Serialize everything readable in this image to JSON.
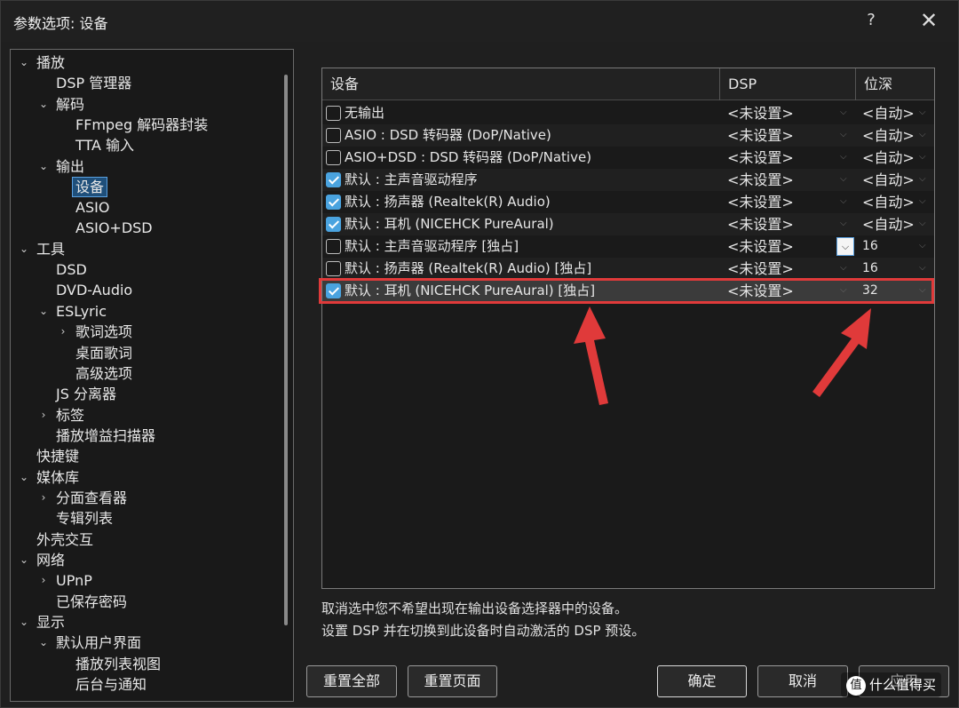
{
  "window": {
    "title": "参数选项: 设备",
    "help_label": "?",
    "close_label": "✕"
  },
  "tree": {
    "items": [
      {
        "label": "播放",
        "arrow": "⌄"
      },
      {
        "label": "DSP 管理器",
        "arrow": ""
      },
      {
        "label": "解码",
        "arrow": "⌄"
      },
      {
        "label": "FFmpeg 解码器封装",
        "arrow": ""
      },
      {
        "label": "TTA 输入",
        "arrow": ""
      },
      {
        "label": "输出",
        "arrow": "⌄"
      },
      {
        "label": "设备",
        "arrow": ""
      },
      {
        "label": "ASIO",
        "arrow": ""
      },
      {
        "label": "ASIO+DSD",
        "arrow": ""
      },
      {
        "label": "工具",
        "arrow": "⌄"
      },
      {
        "label": "DSD",
        "arrow": ""
      },
      {
        "label": "DVD-Audio",
        "arrow": ""
      },
      {
        "label": "ESLyric",
        "arrow": "⌄"
      },
      {
        "label": "歌词选项",
        "arrow": "›"
      },
      {
        "label": "桌面歌词",
        "arrow": ""
      },
      {
        "label": "高级选项",
        "arrow": ""
      },
      {
        "label": "JS 分离器",
        "arrow": ""
      },
      {
        "label": "标签",
        "arrow": "›"
      },
      {
        "label": "播放增益扫描器",
        "arrow": ""
      },
      {
        "label": "快捷键",
        "arrow": ""
      },
      {
        "label": "媒体库",
        "arrow": "⌄"
      },
      {
        "label": "分面查看器",
        "arrow": "›"
      },
      {
        "label": "专辑列表",
        "arrow": ""
      },
      {
        "label": "外壳交互",
        "arrow": ""
      },
      {
        "label": "网络",
        "arrow": "⌄"
      },
      {
        "label": "UPnP",
        "arrow": "›"
      },
      {
        "label": "已保存密码",
        "arrow": ""
      },
      {
        "label": "显示",
        "arrow": "⌄"
      },
      {
        "label": "默认用户界面",
        "arrow": "⌄"
      },
      {
        "label": "播放列表视图",
        "arrow": ""
      },
      {
        "label": "后台与通知",
        "arrow": ""
      }
    ]
  },
  "table": {
    "headers": {
      "device": "设备",
      "dsp": "DSP",
      "depth": "位深"
    },
    "rows": [
      {
        "checked": false,
        "device": "无输出",
        "dsp": "<未设置>",
        "depth": "<自动>"
      },
      {
        "checked": false,
        "device": "ASIO : DSD 转码器 (DoP/Native)",
        "dsp": "<未设置>",
        "depth": "<自动>"
      },
      {
        "checked": false,
        "device": "ASIO+DSD : DSD 转码器 (DoP/Native)",
        "dsp": "<未设置>",
        "depth": "<自动>"
      },
      {
        "checked": true,
        "device": "默认 : 主声音驱动程序",
        "dsp": "<未设置>",
        "depth": "<自动>"
      },
      {
        "checked": true,
        "device": "默认 : 扬声器 (Realtek(R) Audio)",
        "dsp": "<未设置>",
        "depth": "<自动>"
      },
      {
        "checked": true,
        "device": "默认 : 耳机 (NICEHCK PureAural)",
        "dsp": "<未设置>",
        "depth": "<自动>"
      },
      {
        "checked": false,
        "device": "默认 : 主声音驱动程序 [独占]",
        "dsp": "<未设置>",
        "depth": "16"
      },
      {
        "checked": false,
        "device": "默认 : 扬声器 (Realtek(R) Audio) [独占]",
        "dsp": "<未设置>",
        "depth": "16"
      },
      {
        "checked": true,
        "device": "默认 : 耳机 (NICEHCK PureAural) [独占]",
        "dsp": "<未设置>",
        "depth": "32"
      }
    ]
  },
  "info": {
    "line1": "取消选中您不希望出现在输出设备选择器中的设备。",
    "line2": "设置 DSP 并在切换到此设备时自动激活的 DSP 预设。"
  },
  "buttons": {
    "reset_all": "重置全部",
    "reset_page": "重置页面",
    "ok": "确定",
    "cancel": "取消",
    "apply": "应用"
  },
  "watermark": {
    "icon": "值",
    "text": "什么值得买"
  },
  "colors": {
    "highlight_red": "#e03a3a",
    "checkbox_blue": "#4aa3df",
    "selection_blue": "#1f4f7a"
  }
}
